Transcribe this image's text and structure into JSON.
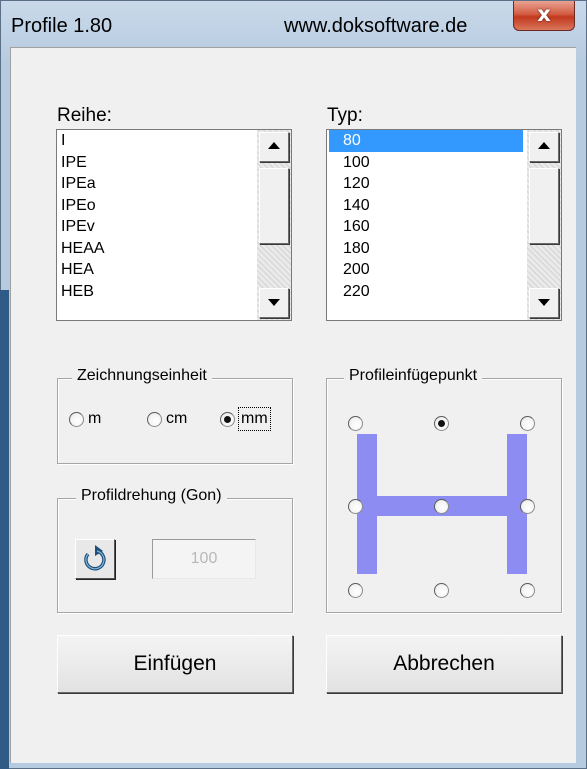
{
  "window": {
    "title": "Profile 1.80",
    "website": "www.doksoftware.de",
    "close_glyph": "x"
  },
  "reihe": {
    "label": "Reihe:",
    "items": [
      "I",
      "IPE",
      "IPEa",
      "IPEo",
      "IPEv",
      "HEAA",
      "HEA",
      "HEB"
    ]
  },
  "typ": {
    "label": "Typ:",
    "selected": "80",
    "items": [
      "80",
      "100",
      "120",
      "140",
      "160",
      "180",
      "200",
      "220"
    ]
  },
  "zeichnungseinheit": {
    "title": "Zeichnungseinheit",
    "options": [
      "m",
      "cm",
      "mm"
    ],
    "selected": "mm"
  },
  "profildrehung": {
    "title": "Profildrehung (Gon)",
    "value": "100",
    "icon": "rotate-icon"
  },
  "profileinfuegepunkt": {
    "title": "Profileinfügepunkt",
    "selected": "top-center",
    "accent_color": "#8c8cf2"
  },
  "buttons": {
    "insert": "Einfügen",
    "cancel": "Abbrechen"
  }
}
